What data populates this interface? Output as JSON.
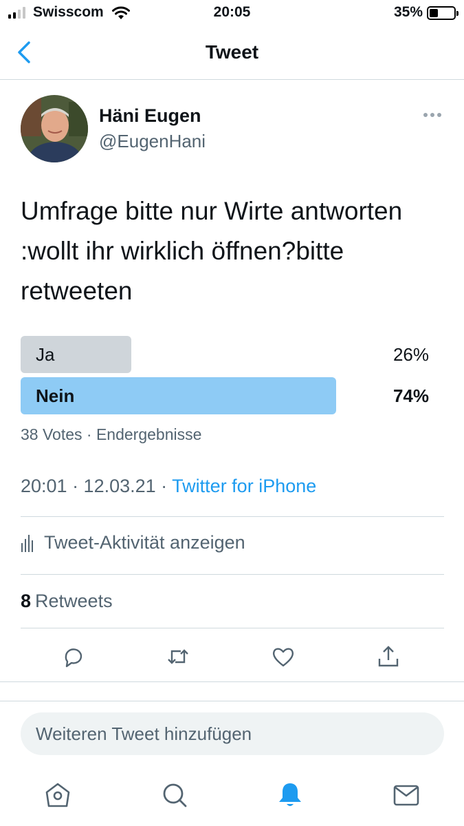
{
  "status_bar": {
    "carrier": "Swisscom",
    "time": "20:05",
    "battery": "35%"
  },
  "nav": {
    "title": "Tweet",
    "back_icon": "chevron-left-icon"
  },
  "tweet": {
    "author_name": "Häni Eugen",
    "author_handle": "@EugenHani",
    "text": "Umfrage bitte nur Wirte antworten :wollt ihr wirklich öffnen?bitte retweeten",
    "poll": {
      "options": [
        {
          "label": "Ja",
          "percent": "26%",
          "fraction": 0.26
        },
        {
          "label": "Nein",
          "percent": "74%",
          "fraction": 0.74
        }
      ],
      "meta": "38 Votes · Endergebnisse"
    },
    "time": "20:01 · 12.03.21 · ",
    "source": "Twitter for iPhone",
    "activity_label": "Tweet-Aktivität anzeigen",
    "retweet_count": "8",
    "retweet_label": "Retweets"
  },
  "compose": {
    "placeholder": "Weiteren Tweet hinzufügen"
  },
  "tabs": [
    "home-icon",
    "search-icon",
    "notifications-icon",
    "messages-icon"
  ],
  "colors": {
    "accent": "#1d9bf0",
    "poll_winner": "#8ecbf5",
    "poll_other": "#cfd5da",
    "secondary_text": "#536471"
  }
}
